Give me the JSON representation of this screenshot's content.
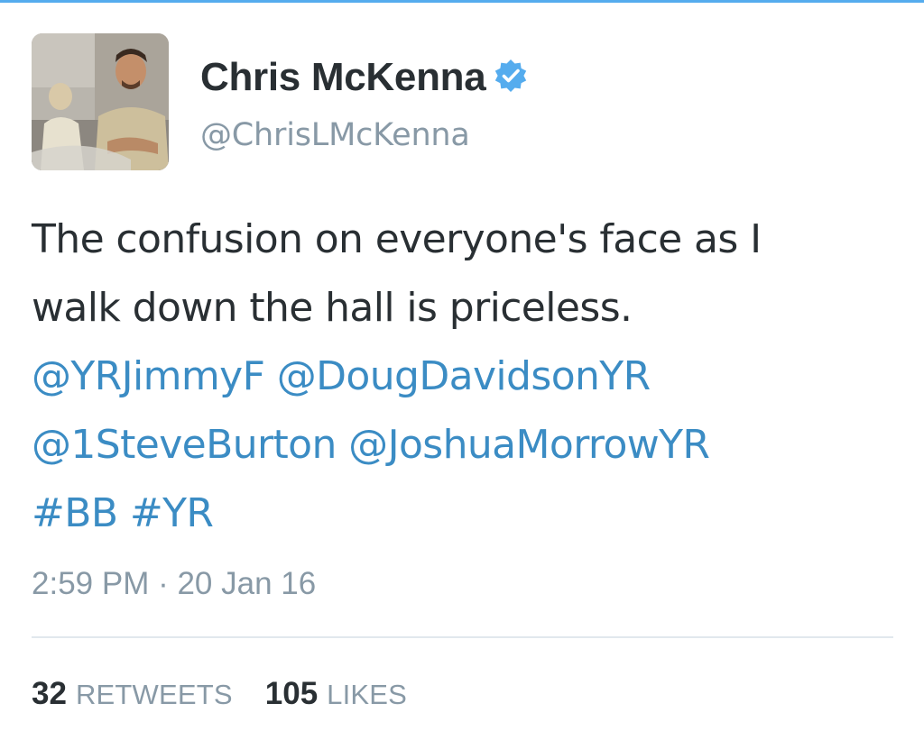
{
  "user": {
    "display_name": "Chris McKenna",
    "handle": "@ChrisLMcKenna",
    "verified": true,
    "avatar_icon": "profile-photo"
  },
  "tweet": {
    "line1": "The confusion on everyone's face as I",
    "line2": "walk down the hall is priceless.",
    "mentions": [
      "@YRJimmyF",
      "@DougDavidsonYR",
      "@1SteveBurton",
      "@JoshuaMorrowYR"
    ],
    "hashtags": [
      "#BB",
      "#YR"
    ],
    "timestamp": "2:59 PM · 20 Jan 16"
  },
  "stats": {
    "retweets_count": "32",
    "retweets_label": "RETWEETS",
    "likes_count": "105",
    "likes_label": "LIKES"
  },
  "colors": {
    "accent": "#55acee",
    "link": "#3b8cc4",
    "text": "#292f33",
    "muted": "#8899a6",
    "divider": "#e1e8ed"
  }
}
